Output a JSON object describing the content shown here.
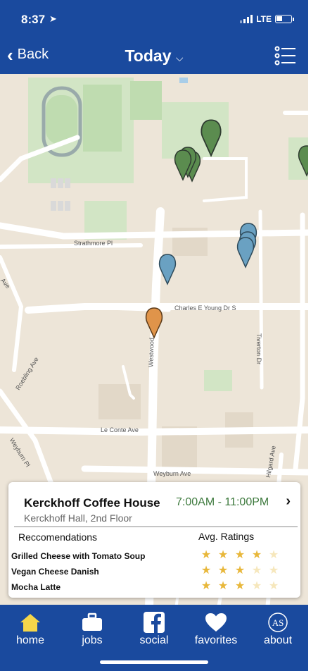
{
  "status": {
    "time": "8:37",
    "network": "LTE"
  },
  "nav": {
    "back_label": "Back",
    "title": "Today"
  },
  "map": {
    "road_labels": [
      "Strathmore Pl",
      "Charles E Young Dr S",
      "Westwood",
      "Roebling Ave",
      "Le Conte Ave",
      "Weyburn Pl",
      "Weyburn Ave",
      "Tiverton Dr",
      "Hilgard Ave",
      "Ave"
    ],
    "marker_colors": {
      "green": "#5b8c4f",
      "blue": "#6aa1c2",
      "orange": "#e0944a"
    }
  },
  "card": {
    "name": "Kerckhoff Coffee House",
    "hours": "7:00AM - 11:00PM",
    "chevron": "›",
    "location": "Kerckhoff Hall, 2nd Floor",
    "rec_header": "Reccomendations",
    "ratings_header": "Avg. Ratings",
    "items": [
      {
        "name": "Grilled Cheese with Tomato Soup",
        "rating": 4
      },
      {
        "name": "Vegan Cheese Danish",
        "rating": 3
      },
      {
        "name": "Mocha Latte",
        "rating": 3
      }
    ],
    "star_colors": {
      "filled": "#e8b73a",
      "empty": "#f6e7bc"
    }
  },
  "tabs": [
    {
      "label": "home",
      "icon": "home-icon",
      "active": true
    },
    {
      "label": "jobs",
      "icon": "briefcase-icon"
    },
    {
      "label": "social",
      "icon": "facebook-icon"
    },
    {
      "label": "favorites",
      "icon": "heart-icon"
    },
    {
      "label": "about",
      "icon": "as-logo-icon",
      "logo_text": "AS"
    }
  ]
}
